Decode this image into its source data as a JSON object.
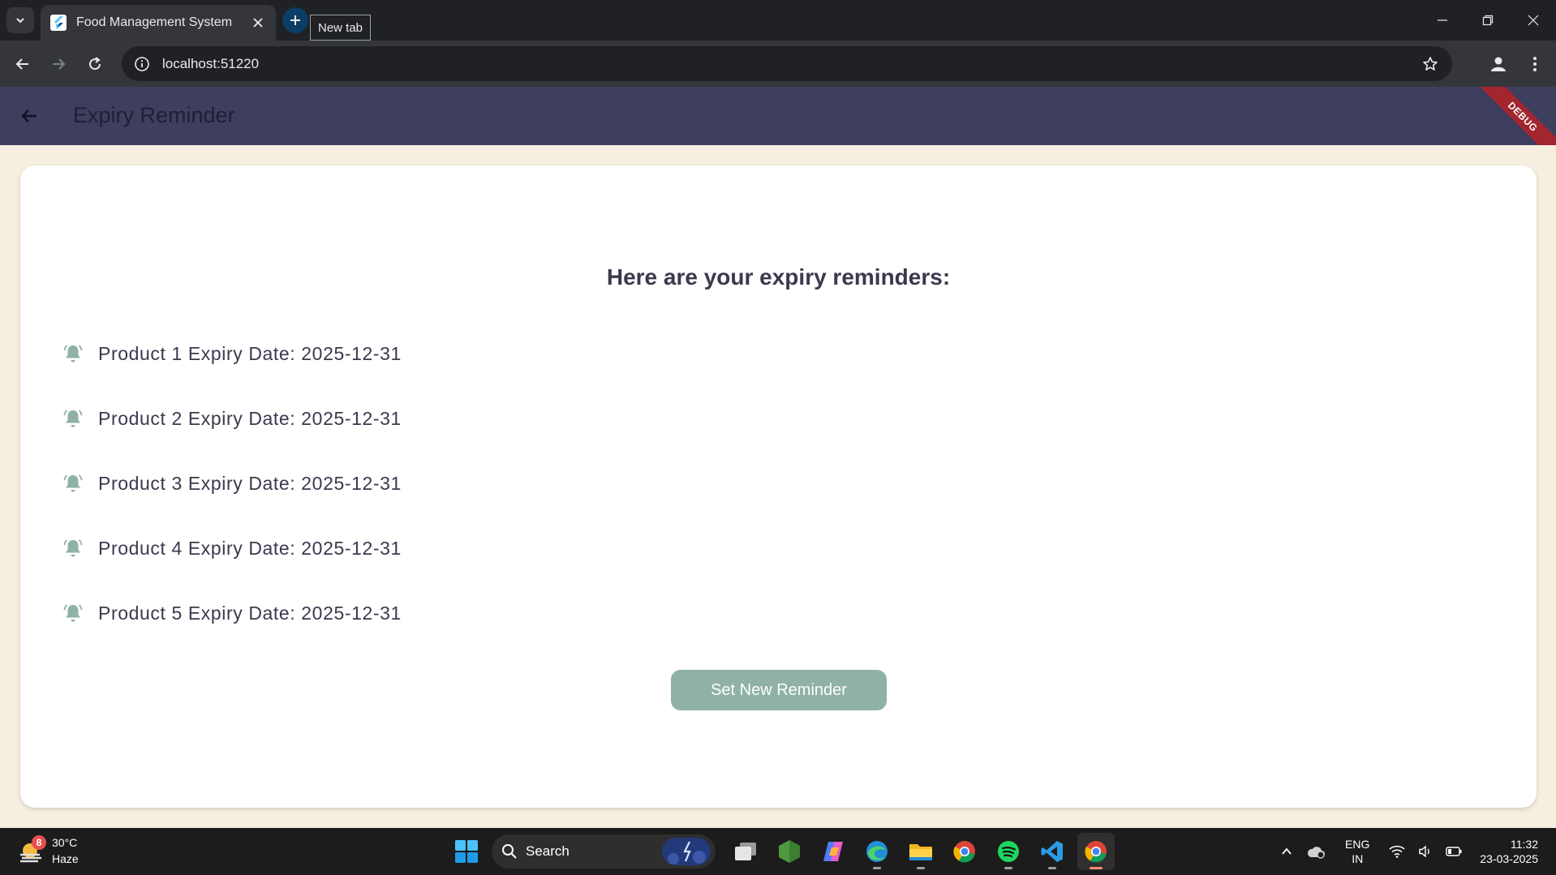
{
  "browser": {
    "tab_title": "Food Management System",
    "tooltip": "New tab",
    "url": "localhost:51220"
  },
  "app": {
    "title": "Expiry Reminder",
    "debug_label": "DEBUG",
    "heading": "Here are your expiry reminders:",
    "reminders": [
      "Product 1 Expiry Date: 2025-12-31",
      "Product 2 Expiry Date: 2025-12-31",
      "Product 3 Expiry Date: 2025-12-31",
      "Product 4 Expiry Date: 2025-12-31",
      "Product 5 Expiry Date: 2025-12-31"
    ],
    "set_button": "Set New Reminder",
    "colors": {
      "appbar": "#3e3f5f",
      "accent": "#8fb2a5",
      "background": "#f6efdf"
    }
  },
  "taskbar": {
    "weather_temp": "30°C",
    "weather_desc": "Haze",
    "weather_badge": "8",
    "search_label": "Search",
    "lang_top": "ENG",
    "lang_bottom": "IN",
    "time": "11:32",
    "date": "23-03-2025"
  }
}
